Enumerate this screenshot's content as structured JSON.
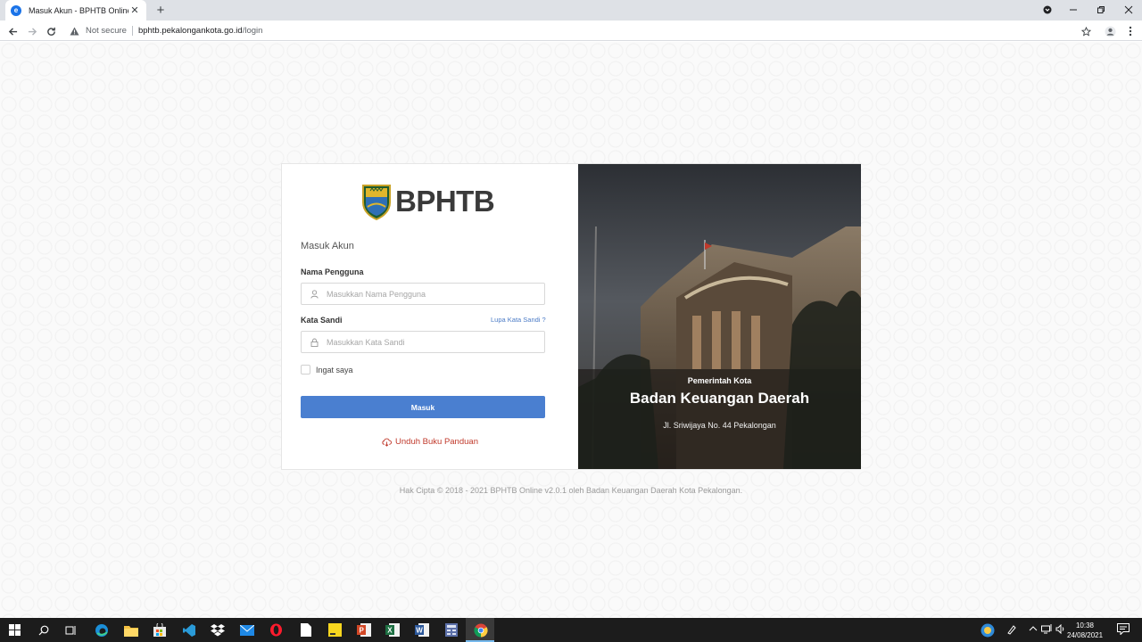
{
  "browser": {
    "tab_title": "Masuk Akun - BPHTB Online",
    "tab_close": "✕",
    "new_tab": "+",
    "security_label": "Not secure",
    "url_host": "bphtb.pekalongankota.go.id",
    "url_path": "/login"
  },
  "login": {
    "logo_text": "BPHTB",
    "title": "Masuk Akun",
    "username_label": "Nama Pengguna",
    "username_placeholder": "Masukkan Nama Pengguna",
    "password_label": "Kata Sandi",
    "password_placeholder": "Masukkan Kata Sandi",
    "forgot_link": "Lupa Kata Sandi ?",
    "remember_label": "Ingat saya",
    "submit_label": "Masuk",
    "download_link": "Unduh Buku Panduan"
  },
  "banner": {
    "subtitle": "Pemerintah Kota",
    "title": "Badan Keuangan Daerah",
    "address": "Jl. Sriwijaya No. 44 Pekalongan"
  },
  "footer": {
    "copyright": "Hak Cipta © 2018 - 2021 BPHTB Online v2.0.1 oleh Badan Keuangan Daerah Kota Pekalongan."
  },
  "taskbar": {
    "time": "10:38",
    "date": "24/08/2021"
  },
  "colors": {
    "primary_button": "#4a7fd0",
    "download_link": "#c0392b",
    "forgot_link": "#4b7bc6"
  }
}
